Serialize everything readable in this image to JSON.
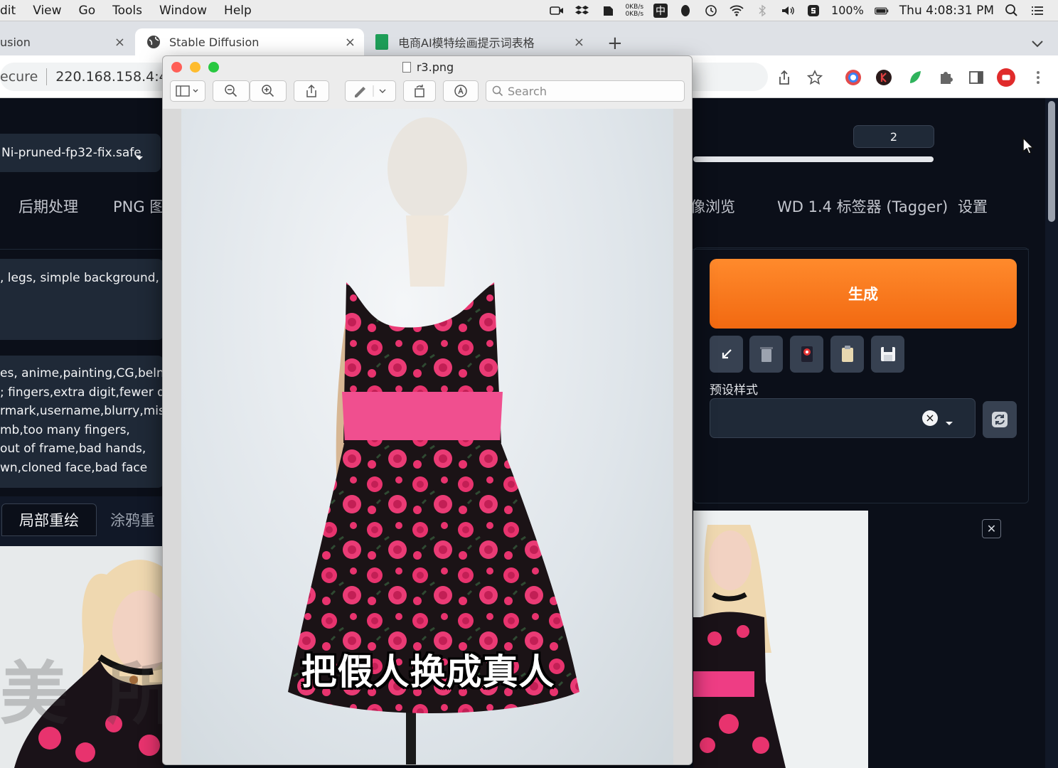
{
  "menubar": {
    "menus": [
      "dit",
      "View",
      "Go",
      "Tools",
      "Window",
      "Help"
    ],
    "net_up": "0KB/s",
    "net_down": "0KB/s",
    "ime": "中",
    "battery": "100%",
    "clock": "Thu 4:08:31 PM"
  },
  "browser": {
    "tabs": [
      {
        "title": "usion"
      },
      {
        "title": "Stable Diffusion"
      },
      {
        "title": "电商AI模特绘画提示词表格"
      }
    ],
    "address_secure": "ecure",
    "address_url": "220.168.158.4:4("
  },
  "webui": {
    "model": "Ni-pruned-fp32-fix.safe",
    "main_tabs": [
      "后期处理",
      "PNG 图",
      "图像浏览",
      "WD 1.4 标签器 (Tagger)",
      "设置"
    ],
    "prompt_lines": [
      ", legs, simple background, s"
    ],
    "negative_lines": [
      "es, anime,painting,CG,belnde",
      "; fingers,extra digit,fewer digi",
      "rmark,username,blurry,missi",
      "mb,too many fingers,",
      "out of frame,bad hands,",
      "wn,cloned face,bad face"
    ],
    "sub_tabs": [
      "局部重绘",
      "涂鸦重"
    ],
    "batch_value": "2",
    "generate_label": "生成",
    "style_label": "预设样式",
    "watermark": [
      "美",
      "所"
    ],
    "colors": {
      "accent": "#f26911",
      "panel": "#1f2937",
      "bg": "#0b0f19"
    }
  },
  "preview": {
    "filename": "r3.png",
    "search_placeholder": "Search",
    "subtitle": "把假人换成真人"
  }
}
